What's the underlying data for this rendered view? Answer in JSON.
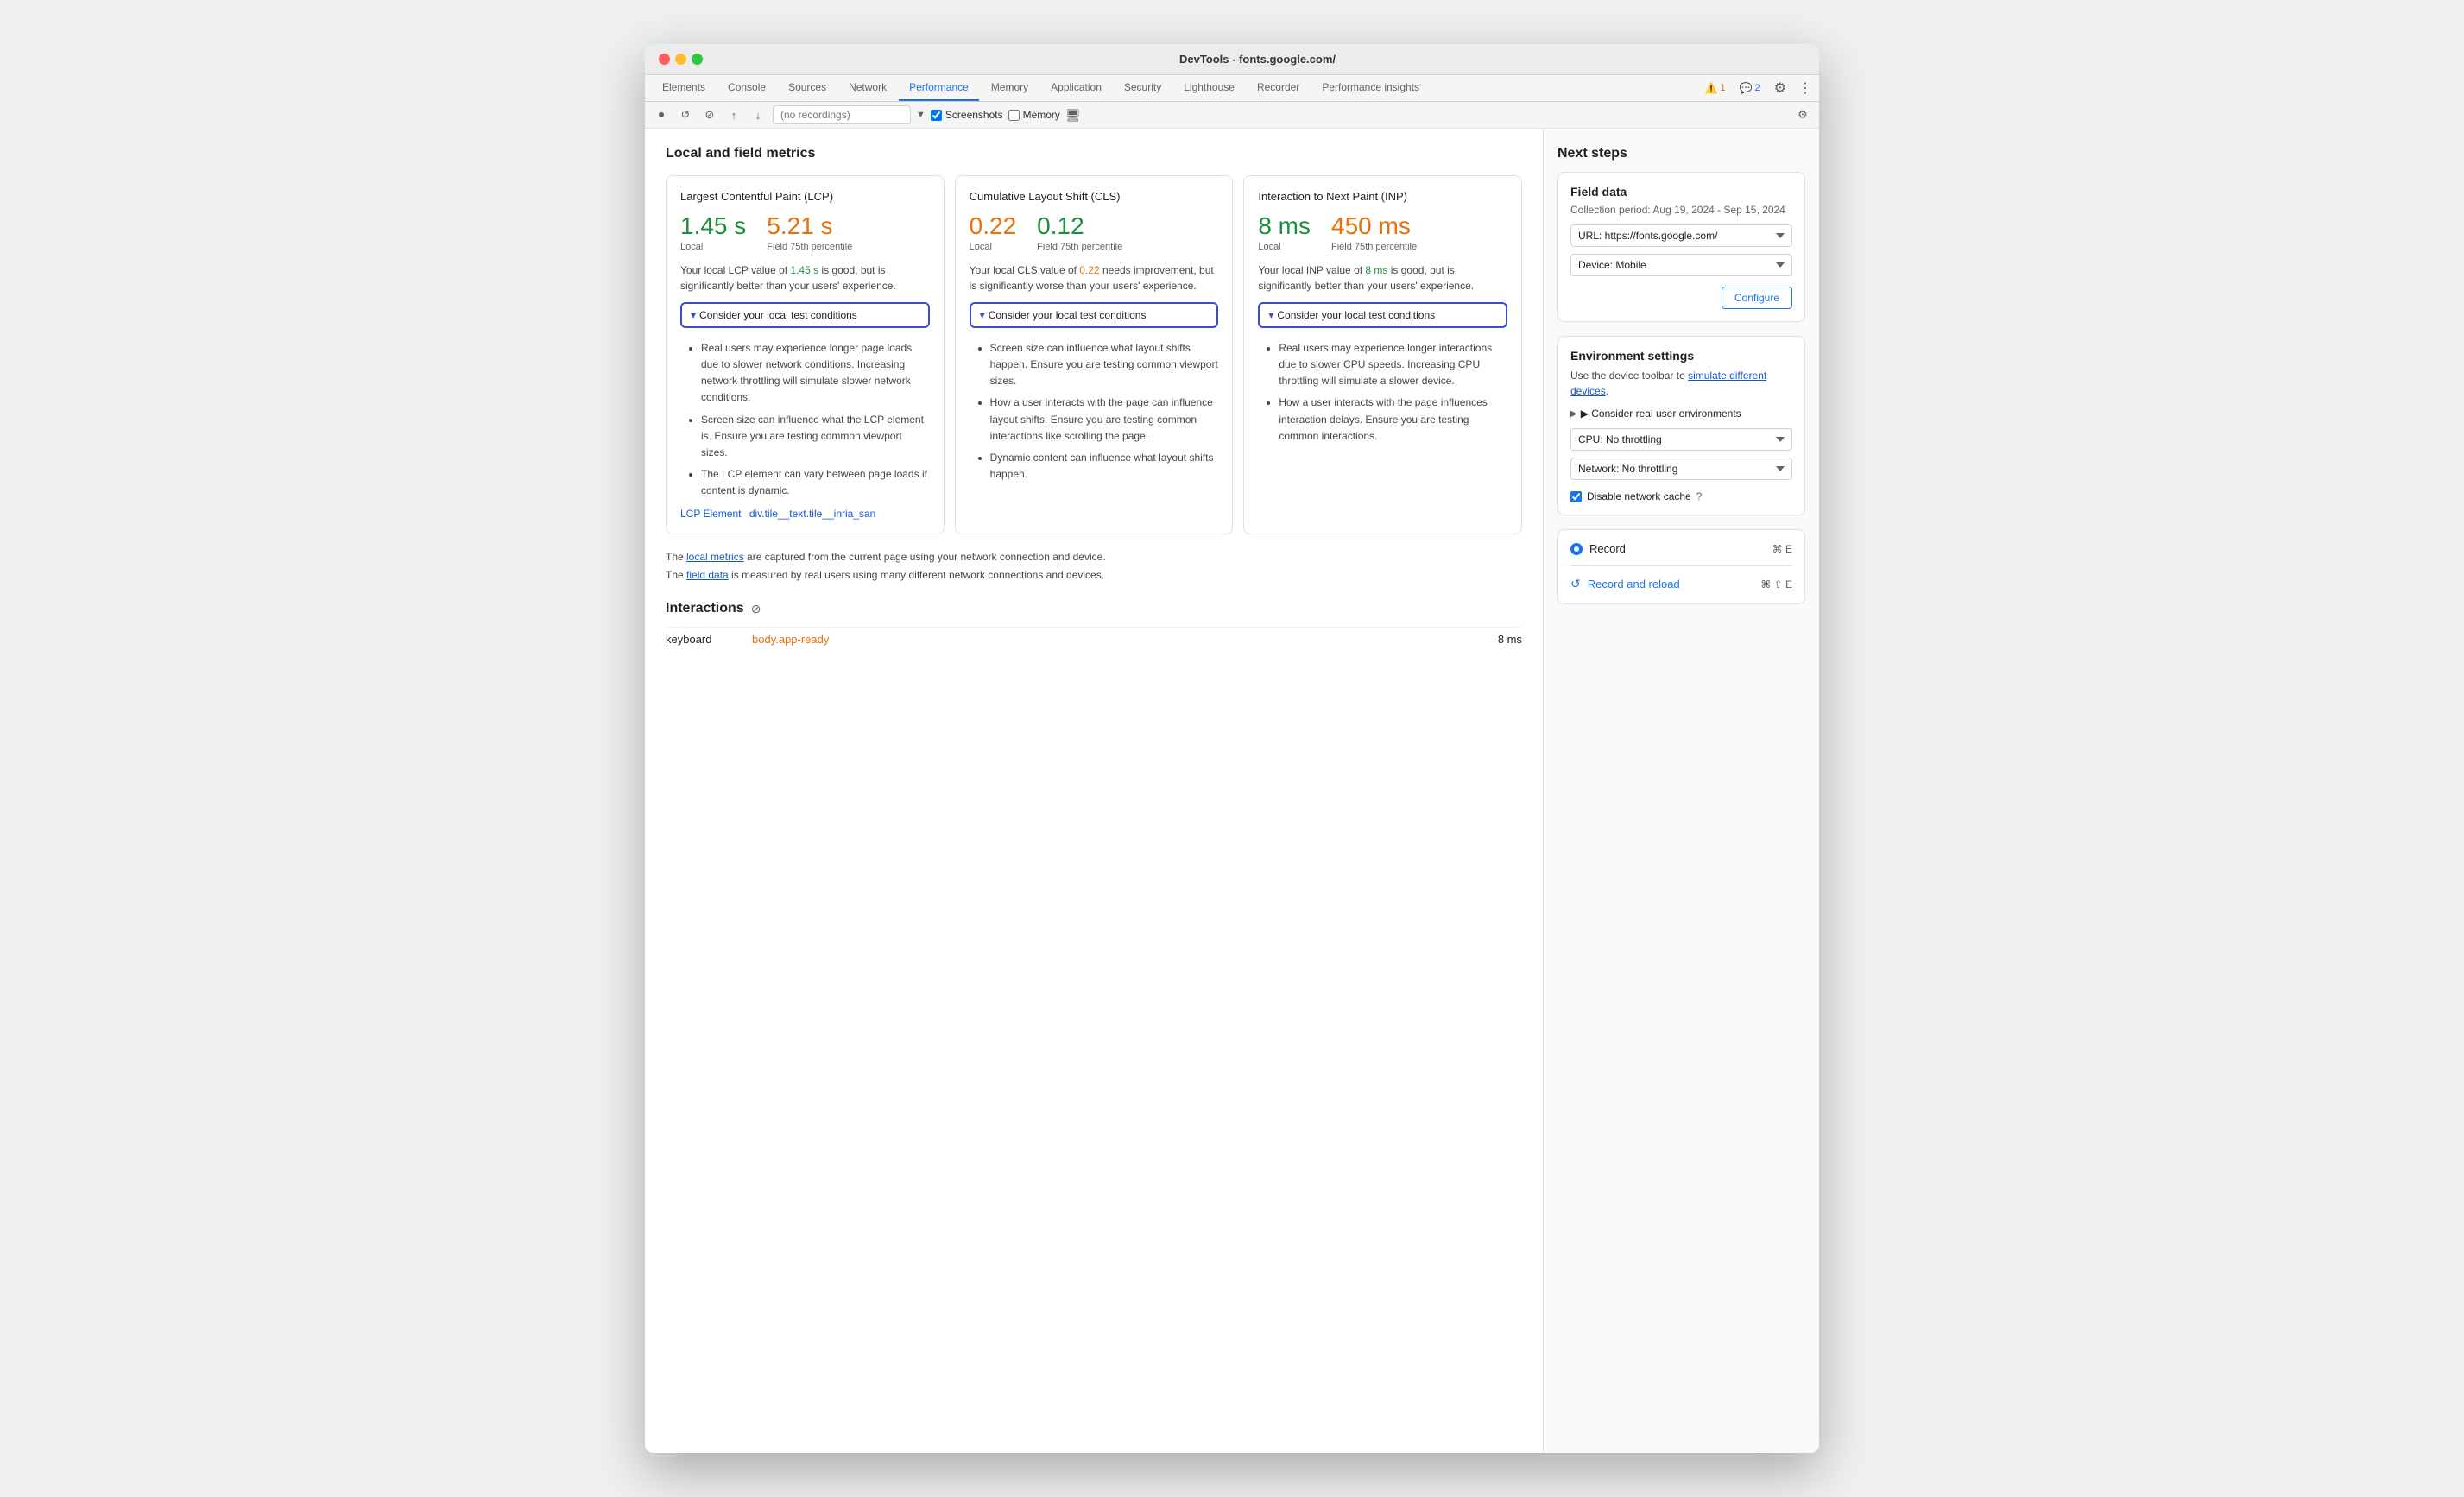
{
  "window": {
    "title": "DevTools - fonts.google.com/"
  },
  "tabs": [
    {
      "label": "Elements",
      "active": false
    },
    {
      "label": "Console",
      "active": false
    },
    {
      "label": "Sources",
      "active": false
    },
    {
      "label": "Network",
      "active": false
    },
    {
      "label": "Performance",
      "active": true
    },
    {
      "label": "Memory",
      "active": false
    },
    {
      "label": "Application",
      "active": false
    },
    {
      "label": "Security",
      "active": false
    },
    {
      "label": "Lighthouse",
      "active": false
    },
    {
      "label": "Recorder",
      "active": false
    },
    {
      "label": "Performance insights",
      "active": false
    }
  ],
  "toolbar": {
    "recording_placeholder": "(no recordings)",
    "screenshots_label": "Screenshots",
    "memory_label": "Memory"
  },
  "metrics_section": {
    "heading": "Local and field metrics"
  },
  "lcp": {
    "title": "Largest Contentful Paint (LCP)",
    "local_value": "1.45 s",
    "local_label": "Local",
    "field_value": "5.21 s",
    "field_label": "Field 75th percentile",
    "description": "Your local LCP value of 1.45 s is good, but is significantly better than your users' experience.",
    "desc_highlight": "1.45 s",
    "consider_label": "▾ Consider your local test conditions",
    "conditions": [
      "Real users may experience longer page loads due to slower network conditions. Increasing network throttling will simulate slower network conditions.",
      "Screen size can influence what the LCP element is. Ensure you are testing common viewport sizes.",
      "The LCP element can vary between page loads if content is dynamic."
    ],
    "lcp_element_label": "LCP Element",
    "lcp_element_value": "div.tile__text.tile__inria_san"
  },
  "cls": {
    "title": "Cumulative Layout Shift (CLS)",
    "local_value": "0.22",
    "local_label": "Local",
    "field_value": "0.12",
    "field_label": "Field 75th percentile",
    "description": "Your local CLS value of 0.22 needs improvement, but is significantly worse than your users' experience.",
    "desc_highlight": "0.22",
    "consider_label": "▾ Consider your local test conditions",
    "conditions": [
      "Screen size can influence what layout shifts happen. Ensure you are testing common viewport sizes.",
      "How a user interacts with the page can influence layout shifts. Ensure you are testing common interactions like scrolling the page.",
      "Dynamic content can influence what layout shifts happen."
    ]
  },
  "inp": {
    "title": "Interaction to Next Paint (INP)",
    "local_value": "8 ms",
    "local_label": "Local",
    "field_value": "450 ms",
    "field_label": "Field 75th percentile",
    "description": "Your local INP value of 8 ms is good, but is significantly better than your users' experience.",
    "desc_highlight": "8 ms",
    "consider_label": "▾ Consider your local test conditions",
    "conditions": [
      "Real users may experience longer interactions due to slower CPU speeds. Increasing CPU throttling will simulate a slower device.",
      "How a user interacts with the page influences interaction delays. Ensure you are testing common interactions."
    ]
  },
  "footer_note": {
    "line1_pre": "The ",
    "line1_link": "local metrics",
    "line1_post": " are captured from the current page using your network connection and device.",
    "line2_pre": "The ",
    "line2_link": "field data",
    "line2_post": " is measured by real users using many different network connections and devices."
  },
  "interactions": {
    "heading": "Interactions",
    "rows": [
      {
        "name": "keyboard",
        "target": "body.app-ready",
        "time": "8 ms"
      }
    ]
  },
  "next_steps": {
    "heading": "Next steps",
    "field_data": {
      "title": "Field data",
      "collection_period": "Collection period: Aug 19, 2024 - Sep 15, 2024",
      "url_label": "URL: https://fonts.google.com/",
      "device_label": "Device: Mobile",
      "configure_label": "Configure"
    },
    "env_settings": {
      "title": "Environment settings",
      "description_pre": "Use the device toolbar to ",
      "description_link": "simulate different devices",
      "description_post": ".",
      "consider_real_label": "▶ Consider real user environments",
      "cpu_label": "CPU: No throttling",
      "network_label": "Network: No throttling",
      "disable_cache_label": "Disable network cache"
    },
    "record": {
      "label": "Record",
      "shortcut": "⌘ E"
    },
    "record_reload": {
      "label": "Record and reload",
      "shortcut": "⌘ ⇧ E"
    }
  }
}
